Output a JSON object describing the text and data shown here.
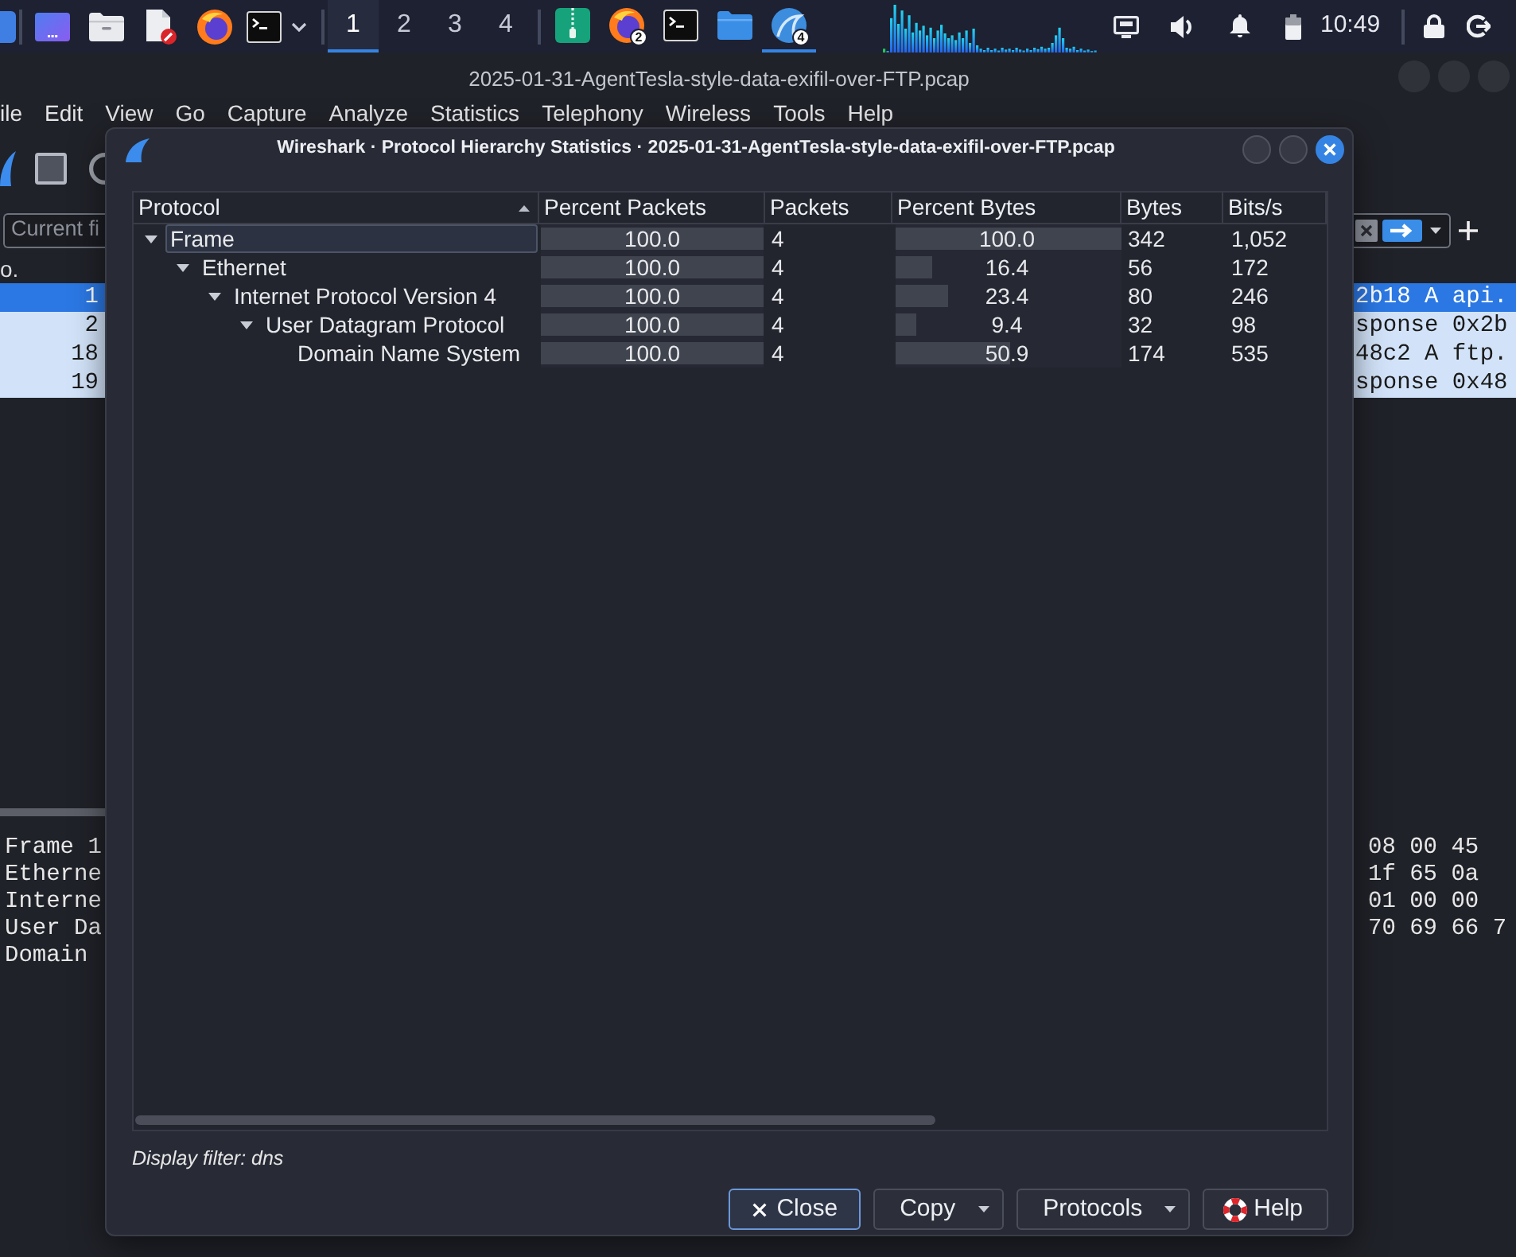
{
  "taskbar": {
    "workspaces": [
      {
        "label": "1",
        "selected": true
      },
      {
        "label": "2",
        "selected": false
      },
      {
        "label": "3",
        "selected": false
      },
      {
        "label": "4",
        "selected": false
      }
    ],
    "tasks": [
      {
        "kind": "archive",
        "selected": false
      },
      {
        "kind": "browser",
        "badge": "2",
        "selected": false
      },
      {
        "kind": "terminal",
        "selected": false
      },
      {
        "kind": "folder",
        "selected": false
      },
      {
        "kind": "capture",
        "badge": "4",
        "selected": true
      }
    ],
    "clock": "10:49"
  },
  "main_window": {
    "title": "2025-01-31-AgentTesla-style-data-exifil-over-FTP.pcap",
    "menu": [
      "ile",
      "Edit",
      "View",
      "Go",
      "Capture",
      "Analyze",
      "Statistics",
      "Telephony",
      "Wireless",
      "Tools",
      "Help"
    ],
    "filter": {
      "placeholder": "Current fi"
    },
    "packet_list": {
      "column_1": "o.",
      "rows": [
        {
          "number": "1",
          "info": "2b18 A api.",
          "selected": true
        },
        {
          "number": "2",
          "info": "sponse 0x2b",
          "selected": false
        },
        {
          "number": "18",
          "info": "48c2 A ftp.",
          "selected": false
        },
        {
          "number": "19",
          "info": "sponse 0x48",
          "selected": false
        }
      ]
    },
    "details": [
      "Frame 1",
      "Etherne",
      "Interne",
      "User Da",
      "Domain"
    ],
    "bytes": [
      "08 00 45",
      "1f 65 0a",
      "01 00 00",
      "70 69 66 7"
    ]
  },
  "dialog": {
    "title": "Wireshark · Protocol Hierarchy Statistics · 2025-01-31-AgentTesla-style-data-exifil-over-FTP.pcap",
    "columns": [
      {
        "label": "Protocol",
        "sorted": true
      },
      {
        "label": "Percent Packets",
        "sorted": false
      },
      {
        "label": "Packets",
        "sorted": false
      },
      {
        "label": "Percent Bytes",
        "sorted": false
      },
      {
        "label": "Bytes",
        "sorted": false
      },
      {
        "label": "Bits/s",
        "sorted": false
      }
    ],
    "tree": [
      {
        "protocol": "Frame",
        "selected": true,
        "expanded": true,
        "percent_packets": {
          "text": "100.0",
          "level": 1
        },
        "packets": "4",
        "percent_bytes": {
          "text": "100.0",
          "level": 1
        },
        "bytes": "342",
        "bits_per_s": "1,052",
        "children": [
          {
            "protocol": "Ethernet",
            "selected": false,
            "expanded": true,
            "percent_packets": {
              "text": "100.0",
              "level": 1
            },
            "packets": "4",
            "percent_bytes": {
              "text": "16.4",
              "level": 0.164
            },
            "bytes": "56",
            "bits_per_s": "172",
            "children": [
              {
                "protocol": "Internet Protocol Version 4",
                "selected": false,
                "expanded": true,
                "percent_packets": {
                  "text": "100.0",
                  "level": 1
                },
                "packets": "4",
                "percent_bytes": {
                  "text": "23.4",
                  "level": 0.234
                },
                "bytes": "80",
                "bits_per_s": "246",
                "children": [
                  {
                    "protocol": "User Datagram Protocol",
                    "selected": false,
                    "expanded": true,
                    "percent_packets": {
                      "text": "100.0",
                      "level": 1
                    },
                    "packets": "4",
                    "percent_bytes": {
                      "text": "9.4",
                      "level": 0.094
                    },
                    "bytes": "32",
                    "bits_per_s": "98",
                    "children": [
                      {
                        "protocol": "Domain Name System",
                        "selected": false,
                        "percent_packets": {
                          "text": "100.0",
                          "level": 1
                        },
                        "packets": "4",
                        "percent_bytes": {
                          "text": "50.9",
                          "level": 0.509
                        },
                        "bytes": "174",
                        "bits_per_s": "535"
                      }
                    ]
                  }
                ]
              }
            ]
          }
        ]
      }
    ],
    "display_filter": "Display filter: dns",
    "buttons": [
      {
        "label": "Close",
        "kind": "close",
        "default": true
      },
      {
        "label": "Copy",
        "kind": "menu",
        "default": false
      },
      {
        "label": "Protocols",
        "kind": "menu",
        "default": false
      },
      {
        "label": "Help",
        "kind": "help",
        "default": false
      }
    ]
  }
}
